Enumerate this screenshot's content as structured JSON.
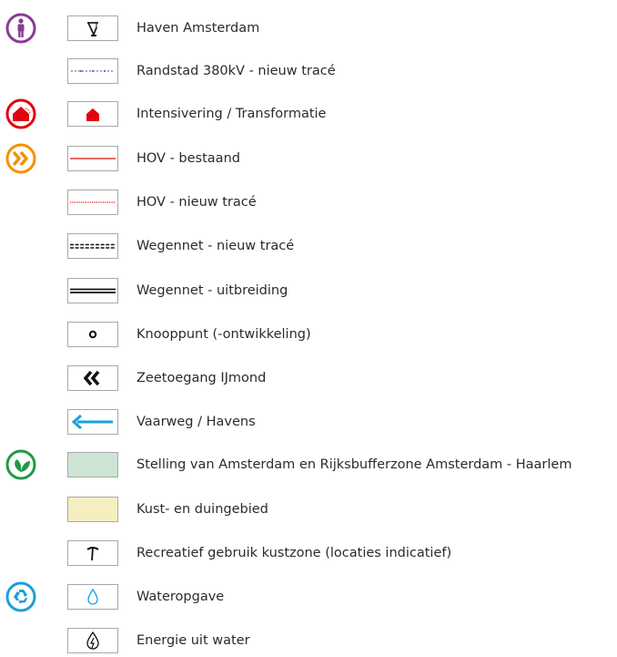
{
  "legend": {
    "items": [
      {
        "label": "Haven Amsterdam",
        "icon": "crane-icon",
        "theme": "purple-person"
      },
      {
        "label": "Randstad 380kV - nieuw tracé",
        "icon": "dashed-blue-line-icon"
      },
      {
        "label": "Intensivering / Transformatie",
        "icon": "red-house-icon",
        "theme": "red-house"
      },
      {
        "label": "HOV - bestaand",
        "icon": "red-line-icon",
        "theme": "orange-chevrons"
      },
      {
        "label": "HOV - nieuw tracé",
        "icon": "red-dotted-line-icon"
      },
      {
        "label": "Wegennet - nieuw tracé",
        "icon": "black-dashed-double-line-icon"
      },
      {
        "label": "Wegennet - uitbreiding",
        "icon": "black-double-line-icon"
      },
      {
        "label": "Knooppunt (-ontwikkeling)",
        "icon": "ring-icon"
      },
      {
        "label": "Zeetoegang IJmond",
        "icon": "double-chevron-icon"
      },
      {
        "label": "Vaarweg / Havens",
        "icon": "blue-arrow-icon"
      },
      {
        "label": "Stelling van Amsterdam en Rijksbufferzone Amsterdam - Haarlem",
        "icon": "green-area-icon",
        "theme": "green-leaf"
      },
      {
        "label": "Kust- en duingebied",
        "icon": "yellow-area-icon"
      },
      {
        "label": "Recreatief gebruik kustzone (locaties indicatief)",
        "icon": "pickaxe-icon"
      },
      {
        "label": "Wateropgave",
        "icon": "water-drop-icon",
        "theme": "blue-recycle"
      },
      {
        "label": "Energie uit water",
        "icon": "energy-drop-icon"
      }
    ]
  },
  "colors": {
    "purple": "#8b3a96",
    "red": "#e3000f",
    "orange": "#f39200",
    "green": "#1f9a48",
    "blue": "#1aa0d8",
    "green_area": "#cde4d5",
    "yellow_area": "#f5efc0"
  }
}
